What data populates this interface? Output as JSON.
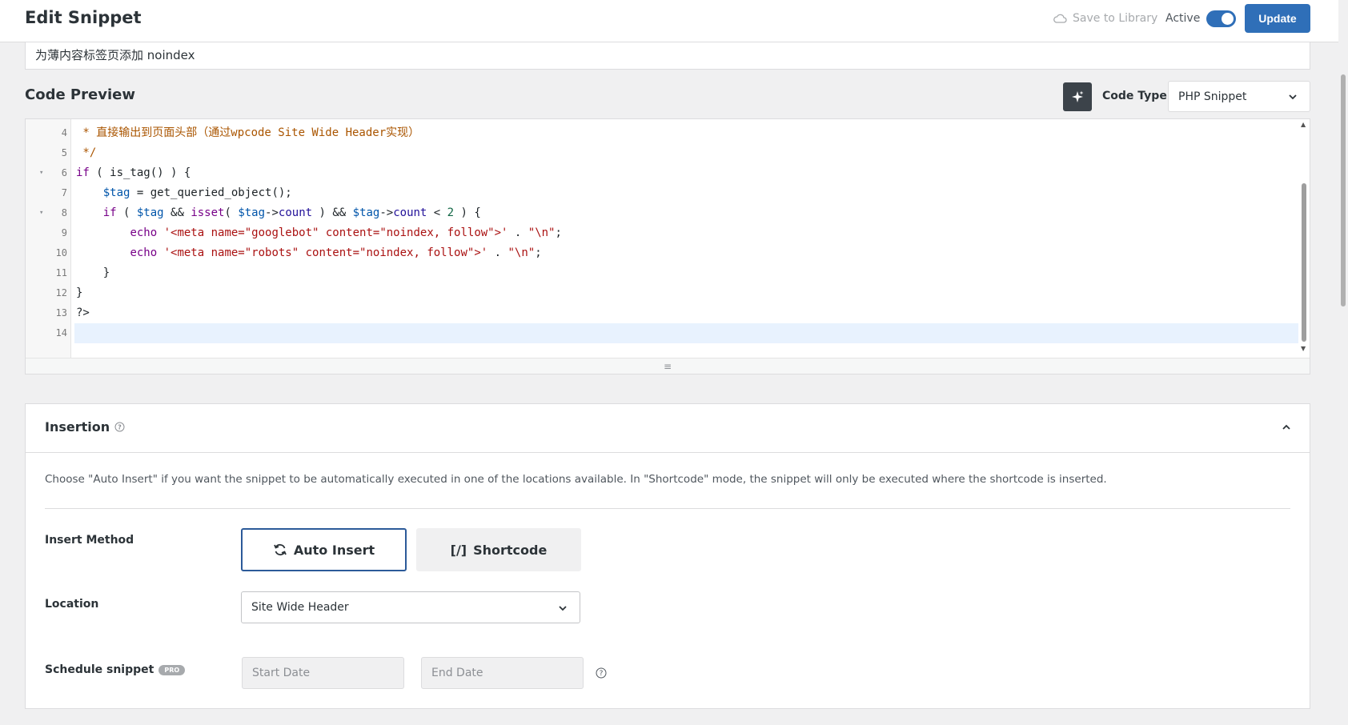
{
  "header": {
    "title": "Edit Snippet",
    "save_to_library": "Save to Library",
    "active_label": "Active",
    "active": true,
    "update_label": "Update",
    "accent_color": "#2f6fb8"
  },
  "snippet_title": "为薄内容标签页添加 noindex",
  "code_preview": {
    "heading": "Code Preview",
    "code_type_label": "Code Type",
    "code_type_value": "PHP Snippet",
    "lines": [
      {
        "no": "4",
        "fold": "",
        "active": false
      },
      {
        "no": "5",
        "fold": "",
        "active": false
      },
      {
        "no": "6",
        "fold": "▾",
        "active": false
      },
      {
        "no": "7",
        "fold": "",
        "active": false
      },
      {
        "no": "8",
        "fold": "▾",
        "active": false
      },
      {
        "no": "9",
        "fold": "",
        "active": false
      },
      {
        "no": "10",
        "fold": "",
        "active": false
      },
      {
        "no": "11",
        "fold": "",
        "active": false
      },
      {
        "no": "12",
        "fold": "",
        "active": false
      },
      {
        "no": "13",
        "fold": "",
        "active": false
      },
      {
        "no": "14",
        "fold": "",
        "active": true
      }
    ],
    "tokens": [
      [
        [
          "c",
          " * 直接输出到页面头部（通过wpcode Site Wide Header实现）"
        ]
      ],
      [
        [
          "c",
          " */"
        ]
      ],
      [
        [
          "k",
          "if"
        ],
        [
          "d",
          " ( is_tag() ) {"
        ]
      ],
      [
        [
          "d",
          "    "
        ],
        [
          "v",
          "$tag"
        ],
        [
          "d",
          " = get_queried_object();"
        ]
      ],
      [
        [
          "d",
          "    "
        ],
        [
          "k",
          "if"
        ],
        [
          "d",
          " ( "
        ],
        [
          "v",
          "$tag"
        ],
        [
          "d",
          " && "
        ],
        [
          "k",
          "isset"
        ],
        [
          "d",
          "( "
        ],
        [
          "v",
          "$tag"
        ],
        [
          "d",
          "->"
        ],
        [
          "p",
          "count"
        ],
        [
          "d",
          " ) && "
        ],
        [
          "v",
          "$tag"
        ],
        [
          "d",
          "->"
        ],
        [
          "p",
          "count"
        ],
        [
          "d",
          " < "
        ],
        [
          "n",
          "2"
        ],
        [
          "d",
          " ) {"
        ]
      ],
      [
        [
          "d",
          "        "
        ],
        [
          "k",
          "echo"
        ],
        [
          "d",
          " "
        ],
        [
          "s",
          "'<meta name=\"googlebot\" content=\"noindex, follow\">'"
        ],
        [
          "d",
          " . "
        ],
        [
          "s",
          "\"\\n\""
        ],
        [
          "d",
          ";"
        ]
      ],
      [
        [
          "d",
          "        "
        ],
        [
          "k",
          "echo"
        ],
        [
          "d",
          " "
        ],
        [
          "s",
          "'<meta name=\"robots\" content=\"noindex, follow\">'"
        ],
        [
          "d",
          " . "
        ],
        [
          "s",
          "\"\\n\""
        ],
        [
          "d",
          ";"
        ]
      ],
      [
        [
          "d",
          "    }"
        ]
      ],
      [
        [
          "d",
          "}"
        ]
      ],
      [
        [
          "d",
          "?>"
        ]
      ],
      [
        [
          "d",
          ""
        ]
      ]
    ],
    "resize_glyph": "≡"
  },
  "insertion": {
    "title": "Insertion",
    "description": "Choose \"Auto Insert\" if you want the snippet to be automatically executed in one of the locations available. In \"Shortcode\" mode, the snippet will only be executed where the shortcode is inserted.",
    "insert_method_label": "Insert Method",
    "auto_insert_label": "Auto Insert",
    "shortcode_label": "Shortcode",
    "shortcode_glyph": "[/]",
    "location_label": "Location",
    "location_value": "Site Wide Header",
    "schedule_label": "Schedule snippet",
    "pro_badge": "PRO",
    "start_date_placeholder": "Start Date",
    "end_date_placeholder": "End Date"
  }
}
